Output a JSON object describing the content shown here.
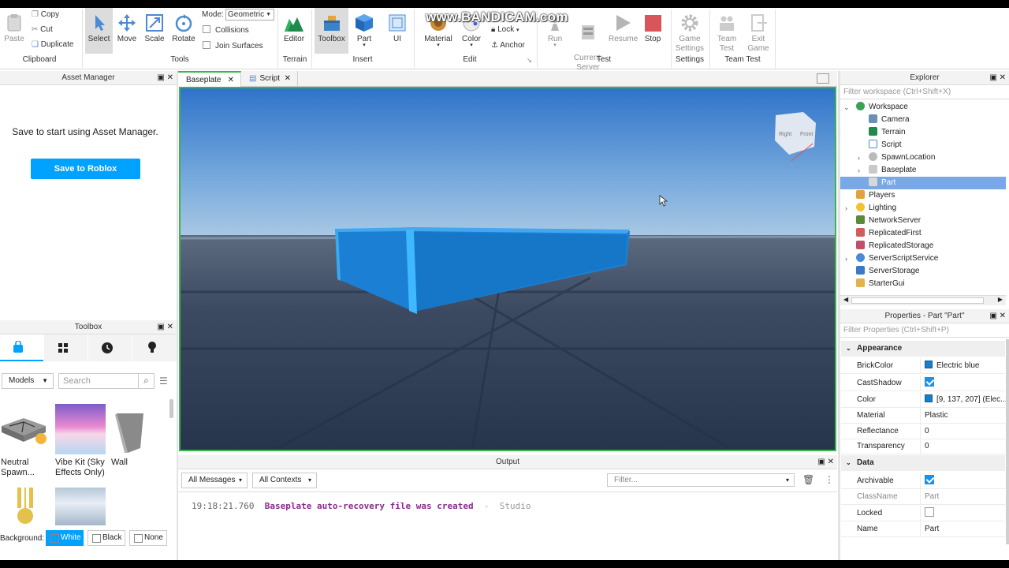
{
  "ribbon": {
    "clipboard": {
      "paste": "Paste",
      "copy": "Copy",
      "cut": "Cut",
      "duplicate": "Duplicate",
      "group": "Clipboard"
    },
    "tools": {
      "select": "Select",
      "move": "Move",
      "scale": "Scale",
      "rotate": "Rotate",
      "mode_label": "Mode:",
      "mode_value": "Geometric",
      "collisions": "Collisions",
      "join_surfaces": "Join Surfaces",
      "group": "Tools"
    },
    "terrain": {
      "editor": "Editor",
      "group": "Terrain"
    },
    "insert": {
      "toolbox": "Toolbox",
      "part": "Part",
      "ui": "UI",
      "group": "Insert"
    },
    "edit": {
      "material": "Material",
      "color": "Color",
      "lock": "Lock",
      "anchor": "Anchor",
      "group": "Edit"
    },
    "test": {
      "run": "Run",
      "current_server": "Current:\nServer",
      "resume": "Resume",
      "stop": "Stop",
      "group": "Test"
    },
    "settings": {
      "game_settings": "Game Settings",
      "group": "Settings"
    },
    "team_test": {
      "team_test": "Team Test",
      "exit_game": "Exit Game",
      "group": "Team Test"
    },
    "watermark": "www.BANDICAM.com"
  },
  "asset_manager": {
    "title": "Asset Manager",
    "message": "Save to start using Asset Manager.",
    "button": "Save to Roblox"
  },
  "toolbox": {
    "title": "Toolbox",
    "category": "Models",
    "search_placeholder": "Search",
    "items": [
      {
        "name": "Neutral Spawn..."
      },
      {
        "name": "Vibe Kit (Sky Effects Only)"
      },
      {
        "name": "Wall"
      }
    ],
    "background_label": "Background:",
    "bg_options": [
      "White",
      "Black",
      "None"
    ]
  },
  "viewport": {
    "tabs": [
      "Baseplate",
      "Script"
    ]
  },
  "output": {
    "title": "Output",
    "filter_messages": "All Messages",
    "filter_contexts": "All Contexts",
    "filter_placeholder": "Filter...",
    "log": [
      {
        "time": "19:18:21.760",
        "message": "Baseplate auto-recovery file was created",
        "sep": "-",
        "source": "Studio"
      }
    ]
  },
  "explorer": {
    "title": "Explorer",
    "filter_placeholder": "Filter workspace (Ctrl+Shift+X)",
    "items": [
      "Workspace",
      "Camera",
      "Terrain",
      "Script",
      "SpawnLocation",
      "Baseplate",
      "Part",
      "Players",
      "Lighting",
      "NetworkServer",
      "ReplicatedFirst",
      "ReplicatedStorage",
      "ServerScriptService",
      "ServerStorage",
      "StarterGui"
    ]
  },
  "properties": {
    "title": "Properties - Part \"Part\"",
    "filter_placeholder": "Filter Properties (Ctrl+Shift+P)",
    "appearance": "Appearance",
    "brickcolor": {
      "key": "BrickColor",
      "value": "Electric blue"
    },
    "castshadow": {
      "key": "CastShadow",
      "checked": true
    },
    "color": {
      "key": "Color",
      "value": "[9, 137, 207] (Elec..."
    },
    "material": {
      "key": "Material",
      "value": "Plastic"
    },
    "reflectance": {
      "key": "Reflectance",
      "value": "0"
    },
    "transparency": {
      "key": "Transparency",
      "value": "0"
    },
    "data": "Data",
    "archivable": {
      "key": "Archivable",
      "checked": true
    },
    "classname": {
      "key": "ClassName",
      "value": "Part"
    },
    "locked": {
      "key": "Locked",
      "checked": false
    },
    "name": {
      "key": "Name",
      "value": "Part"
    }
  },
  "colors": {
    "accent": "#00a2ff",
    "selection": "#7aa7e6",
    "viewport_border": "#39b54a",
    "part": "#1a8fe0"
  }
}
